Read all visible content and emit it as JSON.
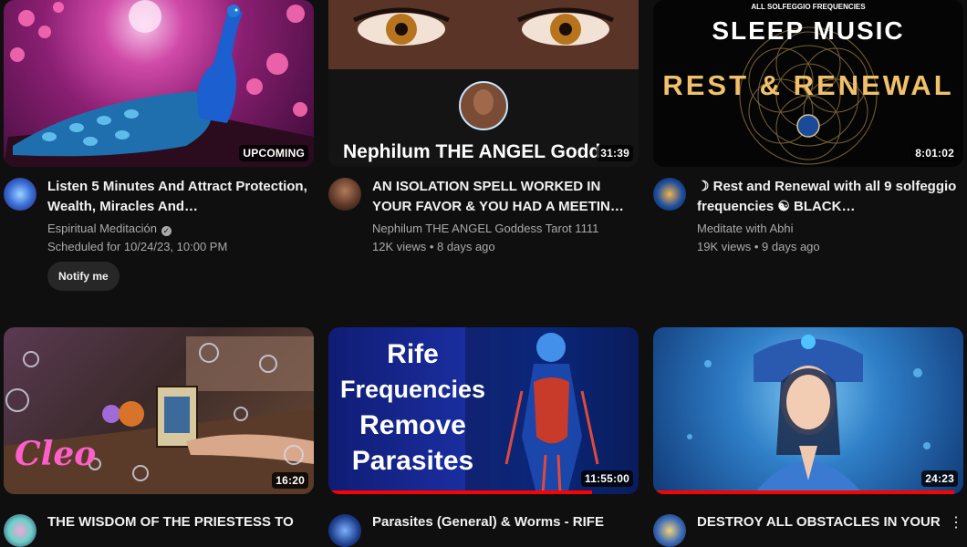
{
  "videos": [
    {
      "title": "Listen 5 Minutes And Attract Protection, Wealth, Miracles And…",
      "channel": "Espiritual Meditación",
      "meta1": "Scheduled for 10/24/23, 10:00 PM",
      "badge": "UPCOMING",
      "button": "Notify me",
      "thumb_icon": "peacock-thumbnail"
    },
    {
      "title": "AN ISOLATION SPELL WORKED IN YOUR FAVOR & YOU HAD A MEETIN…",
      "channel": "Nephilum THE ANGEL Goddess Tarot 1111",
      "meta1": "12K views • 8 days ago",
      "badge": "31:39",
      "thumb_text": "Nephilum THE ANGEL Godd",
      "thumb_icon": "golden-eyes-thumbnail"
    },
    {
      "title": "☽ Rest and Renewal with all 9 solfeggio frequencies ☯ BLACK…",
      "channel": "Meditate with Abhi",
      "meta1": "19K views • 9 days ago",
      "badge": "8:01:02",
      "thumb_small": "ALL SOLFEGGIO FREQUENCIES",
      "thumb_line1": "SLEEP MUSIC",
      "thumb_line2": "REST & RENEWAL",
      "thumb_icon": "sacred-geometry-thumbnail"
    },
    {
      "title": "THE WISDOM OF THE PRIESTESS TO",
      "badge": "16:20",
      "thumb_logo": "Cleo",
      "thumb_icon": "tarot-hand-thumbnail"
    },
    {
      "title": "Parasites (General) & Worms - RIFE",
      "badge": "11:55:00",
      "progress": 0.85,
      "thumb_lines": [
        "Rife",
        "Frequencies",
        "Remove",
        "Parasites"
      ],
      "thumb_icon": "anatomy-thumbnail"
    },
    {
      "title": "DESTROY ALL OBSTACLES IN YOUR",
      "badge": "24:23",
      "progress": 0.97,
      "thumb_icon": "goddess-thumbnail"
    }
  ],
  "colors": {
    "background": "#0f0f0f",
    "text": "#f1f1f1",
    "secondary": "#aaaaaa",
    "progress": "#ff0000"
  }
}
